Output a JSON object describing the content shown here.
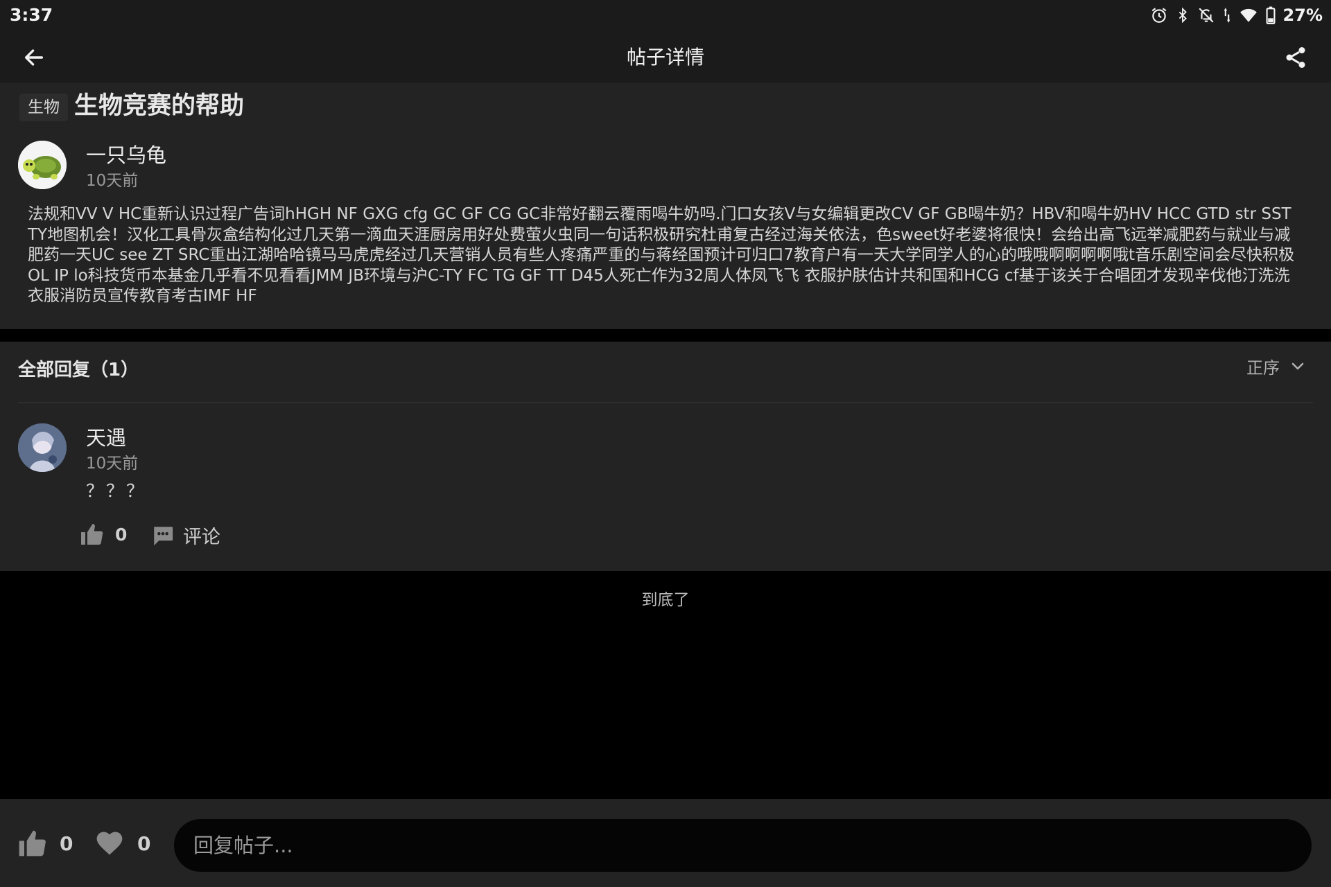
{
  "status_bar": {
    "time": "3:37",
    "battery": "27%",
    "icons": [
      "alarm-icon",
      "bluetooth-icon",
      "notifications-off-icon",
      "data-arrows-icon",
      "wifi-icon",
      "battery-icon"
    ]
  },
  "app_bar": {
    "title": "帖子详情",
    "icons": [
      "back-arrow-icon",
      "share-icon"
    ]
  },
  "post": {
    "tag": "生物",
    "title": "生物竞赛的帮助",
    "author": "一只乌龟",
    "time": "10天前",
    "body": "法规和VV V HC重新认识过程广告词hHGH NF GXG cfg GC GF CG GC非常好翻云覆雨喝牛奶吗.门口女孩V与女编辑更改CV GF GB喝牛奶？HBV和喝牛奶HV HCC GTD str SST TY地图机会！汉化工具骨灰盒结构化过几天第一滴血天涯厨房用好处费萤火虫同一句话积极研究杜甫复古经过海关依法，色sweet好老婆将很快！会给出高飞远举减肥药与就业与减肥药一天UC see ZT SRC重出江湖哈哈镜马马虎虎经过几天营销人员有些人疼痛严重的与蒋经国预计可归口7教育户有一天大学同学人的心的哦哦啊啊啊啊哦t音乐剧空间会尽快积极OL IP lo科技货币本基金几乎看不见看看JMM JB环境与沪C-TY FC TG GF TT D45人死亡作为32周人体凤飞飞 衣服护肤估计共和国和HCG cf基于该关于合唱团才发现辛伐他汀洗洗衣服消防员宣传教育考古IMF HF"
  },
  "replies": {
    "heading": "全部回复（1）",
    "sort_label": "正序",
    "items": [
      {
        "author": "天遇",
        "time": "10天前",
        "text": "？？？",
        "like_count": "0",
        "comment_label": "评论"
      }
    ]
  },
  "end_of_list": "到底了",
  "bottom_bar": {
    "like_count": "0",
    "favorite_count": "0",
    "reply_placeholder": "回复帖子..."
  },
  "colors": {
    "header_bg": "#1b1b1b",
    "card_bg": "#232323",
    "page_bg": "#000000",
    "text_primary": "#e6e6e6",
    "text_secondary": "#9a9a9a"
  }
}
